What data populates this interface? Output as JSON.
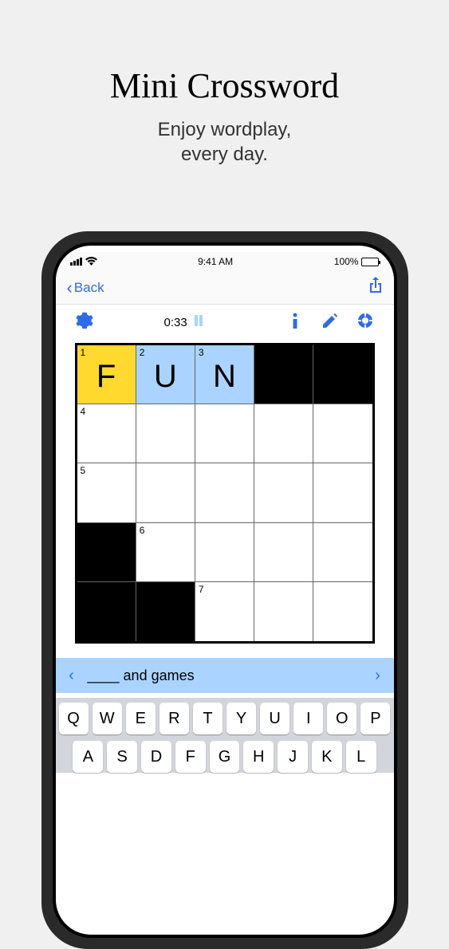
{
  "promo": {
    "title": "Mini Crossword",
    "subtitle_line1": "Enjoy wordplay,",
    "subtitle_line2": "every day."
  },
  "status": {
    "time": "9:41 AM",
    "battery": "100%"
  },
  "nav": {
    "back": "Back"
  },
  "toolbar": {
    "timer": "0:33"
  },
  "grid": {
    "rows": [
      [
        {
          "num": "1",
          "letter": "F",
          "state": "active"
        },
        {
          "num": "2",
          "letter": "U",
          "state": "highlight"
        },
        {
          "num": "3",
          "letter": "N",
          "state": "highlight"
        },
        {
          "state": "black"
        },
        {
          "state": "black"
        }
      ],
      [
        {
          "num": "4"
        },
        {
          "": ""
        },
        {
          "": ""
        },
        {
          "": ""
        },
        {
          "": ""
        }
      ],
      [
        {
          "num": "5"
        },
        {
          "": ""
        },
        {
          "": ""
        },
        {
          "": ""
        },
        {
          "": ""
        }
      ],
      [
        {
          "state": "black"
        },
        {
          "num": "6"
        },
        {
          "": ""
        },
        {
          "": ""
        },
        {
          "": ""
        }
      ],
      [
        {
          "state": "black"
        },
        {
          "state": "black"
        },
        {
          "num": "7"
        },
        {
          "": ""
        },
        {
          "": ""
        }
      ]
    ]
  },
  "clue": {
    "text": "____ and games"
  },
  "keyboard": {
    "row1": [
      "Q",
      "W",
      "E",
      "R",
      "T",
      "Y",
      "U",
      "I",
      "O",
      "P"
    ],
    "row2": [
      "A",
      "S",
      "D",
      "F",
      "G",
      "H",
      "J",
      "K",
      "L"
    ]
  }
}
